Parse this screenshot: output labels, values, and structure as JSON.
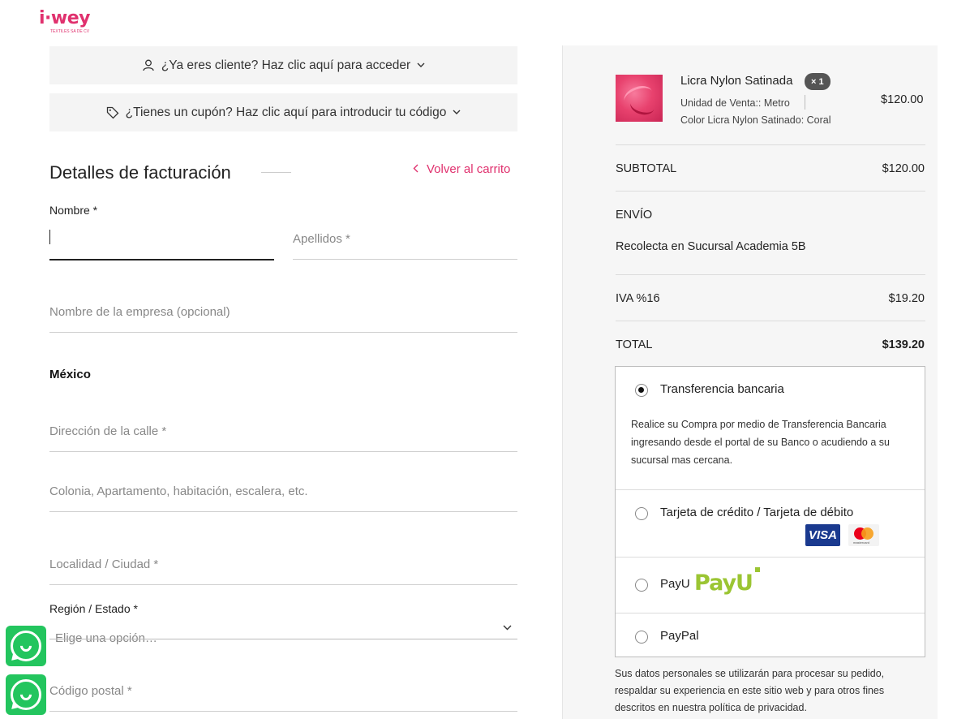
{
  "brand": {
    "logo_text": "i·wey",
    "logo_tagline": "TEXTILES SA DE CV",
    "accent": "#e0316e"
  },
  "notices": {
    "login": "¿Ya eres cliente? Haz clic aquí para acceder",
    "coupon": "¿Tienes un cupón? Haz clic aquí para introducir tu código"
  },
  "billing": {
    "title": "Detalles de facturación",
    "back_to_cart": "Volver al carrito",
    "nombre_label": "Nombre *",
    "nombre_value": "",
    "apellidos_placeholder": "Apellidos *",
    "empresa_placeholder": "Nombre de la empresa (opcional)",
    "country": "México",
    "calle_placeholder": "Dirección de la calle  *",
    "colonia_placeholder": "Colonia, Apartamento, habitación, escalera, etc.",
    "ciudad_placeholder": "Localidad / Ciudad  *",
    "region_label": "Región / Estado  *",
    "region_selected": "Elige una opción…",
    "cp_placeholder": "Código postal  *"
  },
  "order": {
    "product": {
      "name": "Licra Nylon Satinada",
      "qty": "× 1",
      "unit_label": "Unidad de Venta::",
      "unit_value": "Metro",
      "color_label": "Color Licra Nylon Satinado:",
      "color_value": "Coral",
      "price": "$120.00"
    },
    "subtotal_label": "SUBTOTAL",
    "subtotal_value": "$120.00",
    "shipping_label": "ENVÍO",
    "shipping_method": "Recolecta en Sucursal Academia 5B",
    "tax_label": "IVA %16",
    "tax_value": "$19.20",
    "total_label": "TOTAL",
    "total_value": "$139.20"
  },
  "payment": {
    "options": [
      {
        "label": "Transferencia bancaria",
        "selected": true
      },
      {
        "label": "Tarjeta de crédito / Tarjeta de débito",
        "selected": false
      },
      {
        "label": "PayU",
        "selected": false
      },
      {
        "label": "PayPal",
        "selected": false
      }
    ],
    "transfer_description": "Realice su Compra por medio de Transferencia Bancaria ingresando desde el portal de su Banco o acudiendo a su sucursal mas cercana.",
    "visa_text": "VISA",
    "mastercard_text": "mastercard",
    "payu_logo_text": "PayU"
  },
  "privacy_text": "Sus datos personales se utilizarán para procesar su pedido, respaldar su experiencia en este sitio web y para otros fines descritos en nuestra política de privacidad."
}
